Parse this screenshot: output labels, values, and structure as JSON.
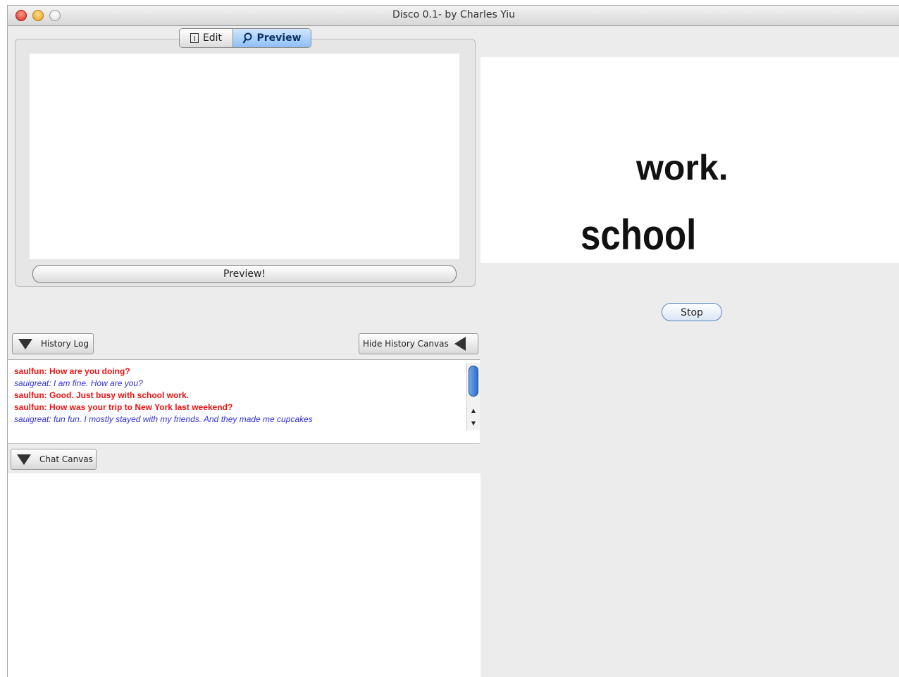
{
  "window": {
    "title": "Disco 0.1- by Charles Yiu"
  },
  "editor": {
    "tabs": [
      {
        "label": "Edit",
        "icon": "edit-icon",
        "selected": false
      },
      {
        "label": "Preview",
        "icon": "magnifier-icon",
        "selected": true
      }
    ],
    "preview_button": "Preview!"
  },
  "canvas": {
    "words": [
      "work.",
      "school"
    ],
    "stop_button": "Stop"
  },
  "history": {
    "toggle_label": "History Log",
    "hide_canvas_label": "Hide History Canvas",
    "messages": [
      {
        "text": "saulfun: How are you doing?",
        "color": "#ee1111",
        "style": "bold"
      },
      {
        "text": "sauigreat: I am fine. How are you?",
        "color": "#3333dd",
        "style": "italic"
      },
      {
        "text": "saulfun: Good. Just busy with school work.",
        "color": "#ee1111",
        "style": "bold"
      },
      {
        "text": "saulfun: How was your trip to New York last weekend?",
        "color": "#ee1111",
        "style": "bold"
      },
      {
        "text": "sauigreat: fun fun. I mostly stayed with my friends. And they made me cupcakes",
        "color": "#3333dd",
        "style": "italic"
      }
    ]
  },
  "chat": {
    "toggle_label": "Chat Canvas"
  }
}
